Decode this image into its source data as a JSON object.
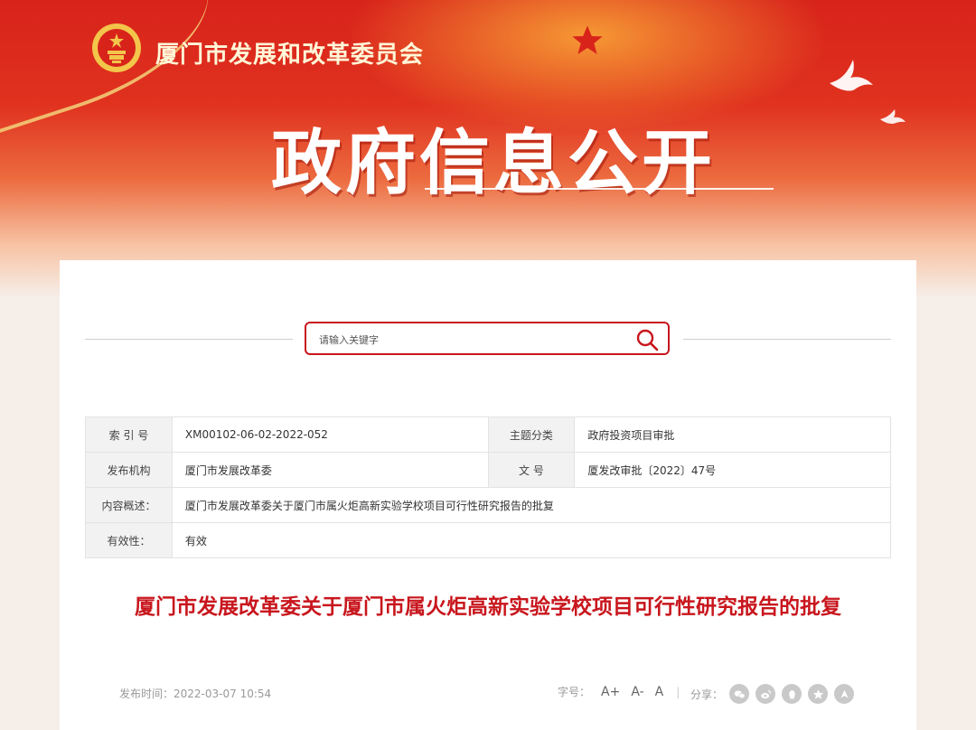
{
  "header": {
    "org_name": "厦门市发展和改革委员会",
    "section_title": "政府信息公开"
  },
  "search": {
    "placeholder": "请输入关键字"
  },
  "meta": {
    "rows": [
      {
        "label1": "索 引 号",
        "value1": "XM00102-06-02-2022-052",
        "label2": "主题分类",
        "value2": "政府投资项目审批"
      },
      {
        "label1": "发布机构",
        "value1": "厦门市发展改革委",
        "label2": "文 号",
        "value2": "厦发改审批〔2022〕47号"
      },
      {
        "label1": "内容概述：",
        "value1": "厦门市发展改革委关于厦门市属火炬高新实验学校项目可行性研究报告的批复"
      },
      {
        "label1": "有效性：",
        "value1": "有效"
      }
    ]
  },
  "article": {
    "title": "厦门市发展改革委关于厦门市属火炬高新实验学校项目可行性研究报告的批复",
    "publish_label": "发布时间：",
    "publish_time": "2022-03-07 10:54",
    "font_size_label": "字号：",
    "font_sizes": [
      "A+",
      "A-",
      "A"
    ],
    "share_label": "分享："
  },
  "icons": {
    "share": [
      "wechat-icon",
      "weibo-icon",
      "qq-icon",
      "qzone-icon",
      "other-share-icon"
    ]
  },
  "colors": {
    "brand_red": "#c8161d",
    "banner_red": "#d8231b",
    "gold": "#f4d27a"
  }
}
